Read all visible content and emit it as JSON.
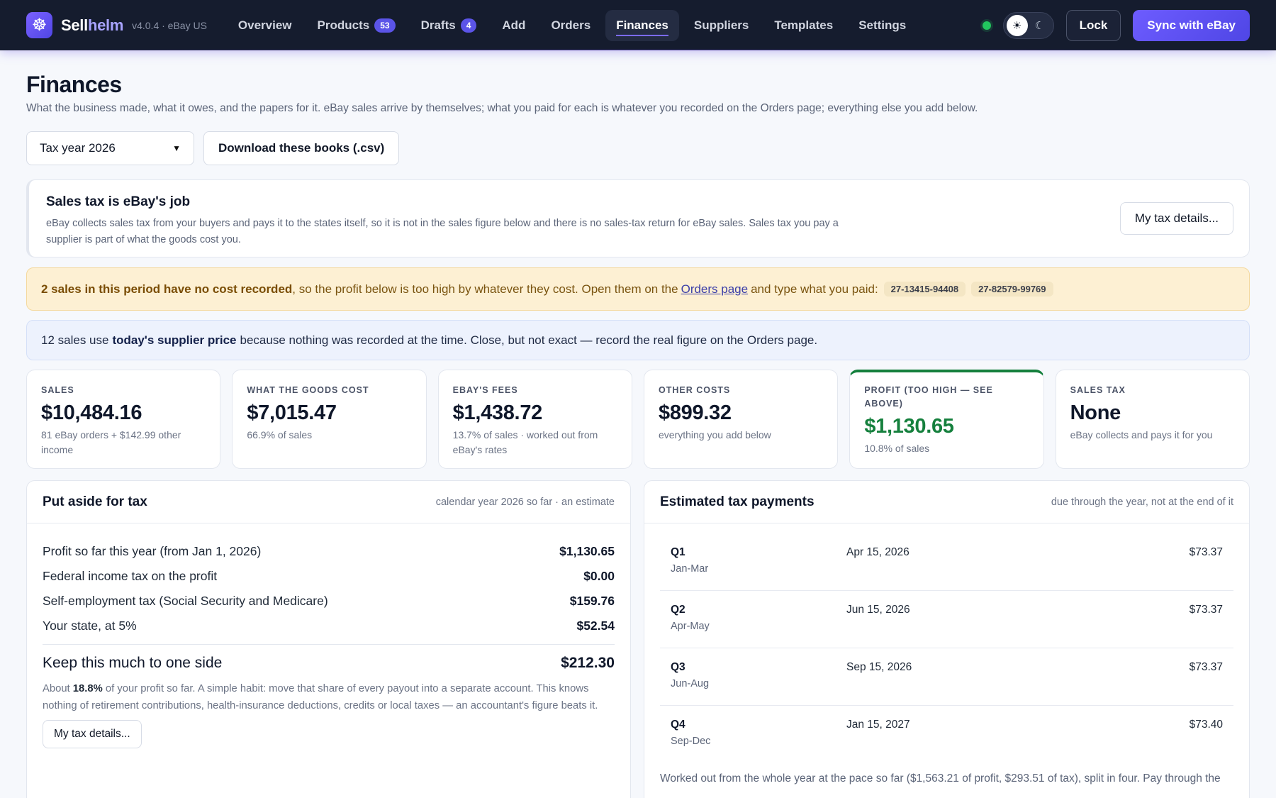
{
  "app": {
    "brand_first": "Sell",
    "brand_second": "helm",
    "version": "v4.0.4 · eBay US",
    "logo_icon": "ship-wheel-icon"
  },
  "nav": [
    {
      "label": "Overview"
    },
    {
      "label": "Products",
      "badge": "53"
    },
    {
      "label": "Drafts",
      "badge": "4"
    },
    {
      "label": "Add"
    },
    {
      "label": "Orders"
    },
    {
      "label": "Finances",
      "active": true
    },
    {
      "label": "Suppliers"
    },
    {
      "label": "Templates"
    },
    {
      "label": "Settings"
    }
  ],
  "topbar": {
    "lock_label": "Lock",
    "sync_label": "Sync with eBay",
    "sun_icon": "☀",
    "moon_icon": "☾"
  },
  "page": {
    "title": "Finances",
    "description": "What the business made, what it owes, and the papers for it. eBay sales arrive by themselves; what you paid for each is whatever you recorded on the Orders page; everything else you add below.",
    "year_select": "Tax year 2026",
    "download_label": "Download these books (.csv)"
  },
  "sales_tax_card": {
    "title": "Sales tax is eBay's job",
    "body": "eBay collects sales tax from your buyers and pays it to the states itself, so it is not in the sales figure below and there is no sales-tax return for eBay sales. Sales tax you pay a supplier is part of what the goods cost you.",
    "button": "My tax details..."
  },
  "warning": {
    "bold": "2 sales in this period have no cost recorded",
    "text1": ", so the profit below is too high by whatever they cost. Open them on the",
    "link": "Orders page",
    "text2": "and type what you paid:",
    "orders": [
      "27-13415-94408",
      "27-82579-99769"
    ]
  },
  "info": {
    "text1": "12 sales use",
    "bold": "today's supplier price",
    "text2": "because nothing was recorded at the time. Close, but not exact — record the real figure on the Orders page."
  },
  "stats": [
    {
      "label": "Sales",
      "value": "$10,484.16",
      "sub": "81 eBay orders + $142.99 other income"
    },
    {
      "label": "What the goods cost",
      "value": "$7,015.47",
      "sub": "66.9% of sales"
    },
    {
      "label": "eBay's fees",
      "value": "$1,438.72",
      "sub": "13.7% of sales · worked out from eBay's rates"
    },
    {
      "label": "Other costs",
      "value": "$899.32",
      "sub": "everything you add below"
    },
    {
      "label": "Profit (too high — see above)",
      "value": "$1,130.65",
      "sub": "10.8% of sales"
    },
    {
      "label": "Sales tax",
      "value": "None",
      "sub": "eBay collects and pays it for you"
    }
  ],
  "put_aside": {
    "title": "Put aside for tax",
    "hint": "calendar year 2026 so far · an estimate",
    "rows": [
      {
        "label": "Profit so far this year (from Jan 1, 2026)",
        "amount": "$1,130.65"
      },
      {
        "label": "Federal income tax on the profit",
        "amount": "$0.00"
      },
      {
        "label": "Self-employment tax (Social Security and Medicare)",
        "amount": "$159.76"
      },
      {
        "label": "Your state, at 5%",
        "amount": "$52.54"
      }
    ],
    "keep_label": "Keep this much to one side",
    "keep_amount": "$212.30",
    "note_pre": "About",
    "note_pct": "18.8%",
    "note_post": "of your profit so far. A simple habit: move that share of every payout into a separate account. This knows nothing of retirement contributions, health-insurance deductions, credits or local taxes — an accountant's figure beats it.",
    "button": "My tax details..."
  },
  "estimated": {
    "title": "Estimated tax payments",
    "hint": "due through the year, not at the end of it",
    "payments": [
      {
        "q": "Q1",
        "range": "Jan-Mar",
        "date": "Apr 15, 2026",
        "amount": "$73.37"
      },
      {
        "q": "Q2",
        "range": "Apr-May",
        "date": "Jun 15, 2026",
        "amount": "$73.37"
      },
      {
        "q": "Q3",
        "range": "Jun-Aug",
        "date": "Sep 15, 2026",
        "amount": "$73.37"
      },
      {
        "q": "Q4",
        "range": "Sep-Dec",
        "date": "Jan 15, 2027",
        "amount": "$73.40"
      }
    ],
    "note": "Worked out from the whole year at the pace so far ($1,563.21 of profit, $293.51 of tax), split in four. Pay through the"
  },
  "colors": {
    "accent": "#5b54e8",
    "profit_green": "#15803d",
    "warning_bg": "#fdf0d3",
    "info_bg": "#edf2fd",
    "topbar_bg": "#151c2e"
  }
}
